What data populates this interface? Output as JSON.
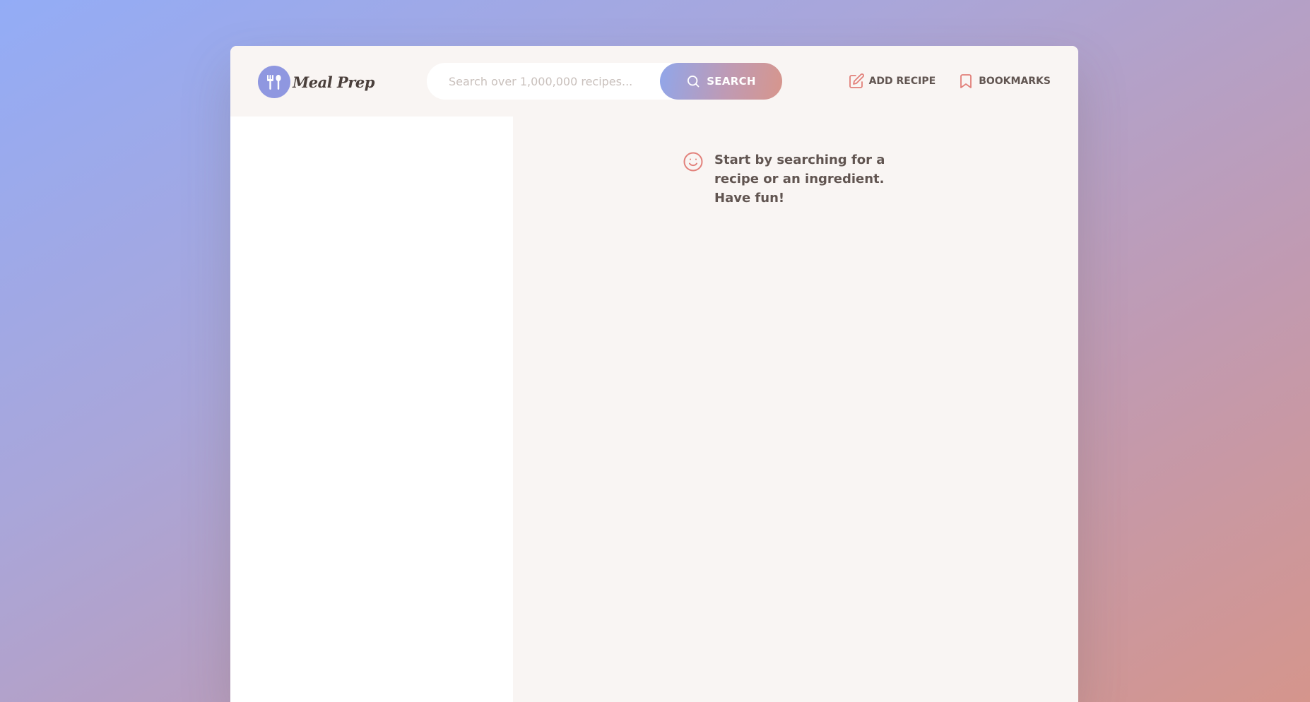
{
  "app": {
    "logo_text": "Meal Prep",
    "logo_icon": "fork-spoon-icon"
  },
  "search": {
    "placeholder": "Search over 1,000,000 recipes...",
    "value": "",
    "button_label": "SEARCH",
    "button_icon": "search-icon"
  },
  "nav": {
    "add_recipe_label": "ADD RECIPE",
    "add_recipe_icon": "edit-icon",
    "bookmarks_label": "BOOKMARKS",
    "bookmarks_icon": "bookmark-icon"
  },
  "recipe": {
    "message": "Start by searching for a recipe or an ingredient. Have fun!",
    "message_icon": "smile-icon"
  },
  "colors": {
    "accent_start": "#90a6ea",
    "accent_end": "#d7968c",
    "icon": "#e2807a",
    "text": "#615551",
    "panel": "#f9f5f3"
  }
}
